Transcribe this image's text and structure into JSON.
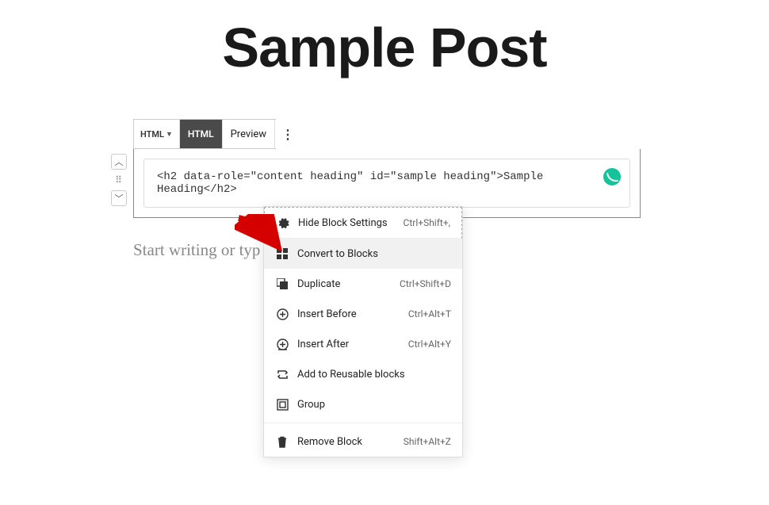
{
  "title": "Sample Post",
  "toolbar": {
    "type_label": "HTML",
    "html_tab": "HTML",
    "preview_tab": "Preview"
  },
  "code_field": "<h2 data-role=\"content heading\" id=\"sample heading\">Sample Heading</h2>",
  "placeholder": "Start writing or type / to choose a block",
  "placeholder_visible": "Start writing or typ",
  "menu": {
    "items": [
      {
        "icon": "gear",
        "label": "Hide Block Settings",
        "shortcut": "Ctrl+Shift+,",
        "top": true
      },
      {
        "icon": "blocks",
        "label": "Convert to Blocks",
        "shortcut": "",
        "hover": true
      },
      {
        "icon": "duplicate",
        "label": "Duplicate",
        "shortcut": "Ctrl+Shift+D"
      },
      {
        "icon": "insert-before",
        "label": "Insert Before",
        "shortcut": "Ctrl+Alt+T"
      },
      {
        "icon": "insert-after",
        "label": "Insert After",
        "shortcut": "Ctrl+Alt+Y"
      },
      {
        "icon": "reusable",
        "label": "Add to Reusable blocks",
        "shortcut": ""
      },
      {
        "icon": "group",
        "label": "Group",
        "shortcut": ""
      },
      {
        "divider": true
      },
      {
        "icon": "trash",
        "label": "Remove Block",
        "shortcut": "Shift+Alt+Z"
      }
    ]
  }
}
